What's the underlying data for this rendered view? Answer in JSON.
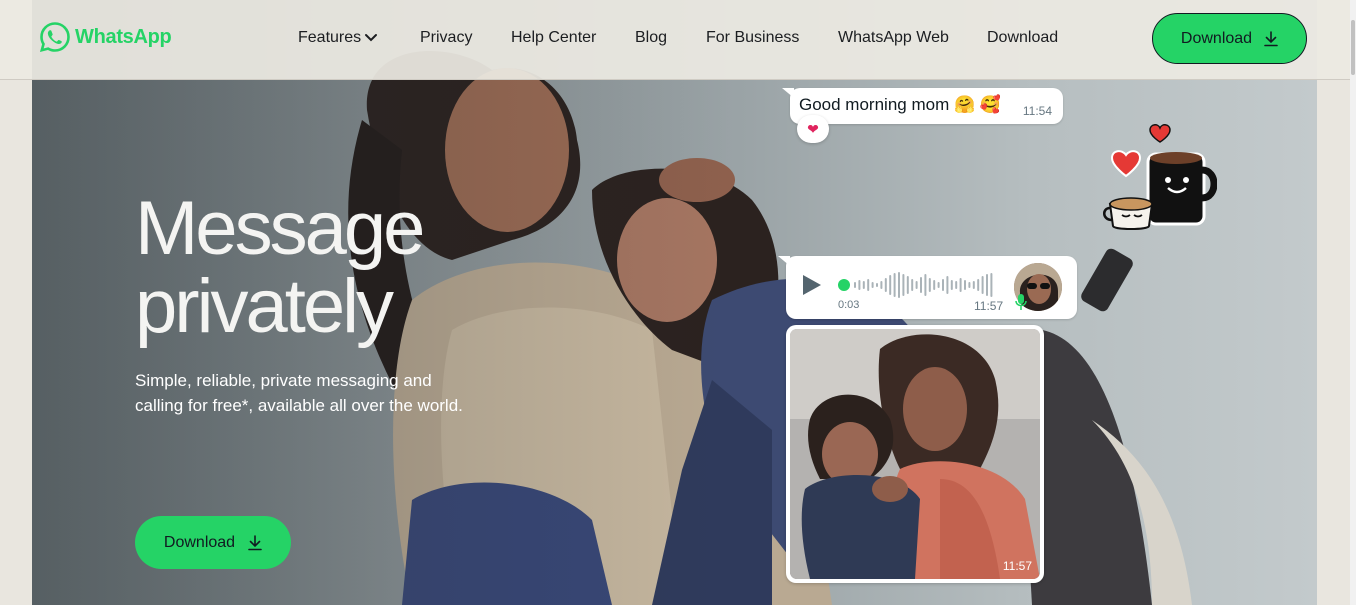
{
  "header": {
    "logo_text": "WhatsApp",
    "nav": [
      {
        "label": "Features",
        "has_dropdown": true
      },
      {
        "label": "Privacy"
      },
      {
        "label": "Help Center"
      },
      {
        "label": "Blog"
      },
      {
        "label": "For Business"
      },
      {
        "label": "WhatsApp Web"
      },
      {
        "label": "Download"
      }
    ],
    "download_button": "Download"
  },
  "hero": {
    "headline_line1": "Message",
    "headline_line2": "privately",
    "subtext": "Simple, reliable, private messaging and calling for free*, available all over the world.",
    "download_button": "Download"
  },
  "chat": {
    "message": {
      "text": "Good morning mom 🤗 🥰",
      "time": "11:54",
      "reaction": "❤"
    },
    "voice_note": {
      "duration": "0:03",
      "time": "11:57",
      "progress": 0.0
    },
    "photo": {
      "time": "11:57"
    }
  },
  "colors": {
    "brand_green": "#25d366",
    "dark_text": "#111b21",
    "heart_red": "#e53935"
  },
  "icons": [
    "whatsapp-logo-icon",
    "chevron-down-icon",
    "download-icon",
    "play-icon",
    "microphone-icon",
    "heart-icon",
    "coffee-mugs-sticker"
  ]
}
